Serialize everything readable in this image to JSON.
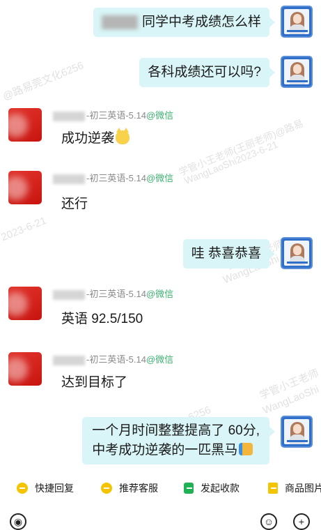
{
  "messages": {
    "m1": {
      "text": "同学中考成绩怎么样"
    },
    "m2": {
      "text": "各科成绩还可以吗?"
    },
    "m3": {
      "sender_suffix": "-初三英语-5.14",
      "wechat": "@微信",
      "text": "成功逆袭"
    },
    "m4": {
      "sender_suffix": "-初三英语-5.14",
      "wechat": "@微信",
      "text": "还行"
    },
    "m5": {
      "text": "哇 恭喜恭喜"
    },
    "m6": {
      "sender_suffix": "-初三英语-5.14",
      "wechat": "@微信",
      "text": "英语 92.5/150"
    },
    "m7": {
      "sender_suffix": "-初三英语-5.14",
      "wechat": "@微信",
      "text": "达到目标了"
    },
    "m8": {
      "line1": "一个月时间整整提高了 60分,",
      "line2": "中考成功逆袭的一匹黑马"
    }
  },
  "watermarks": {
    "w1": "@路易莞文化6256",
    "w2": "学管小王老师(王丽老师)@路易",
    "w3": "WangLaoShi2023-6-21",
    "w4": "学管小王老师",
    "w5": "WangLaoShi",
    "w6": "6256",
    "w7": "学管小王老师",
    "w8": "WangLaoShi",
    "w9": "2023-6-21"
  },
  "quick": {
    "q1": "快捷回复",
    "q2": "推荐客服",
    "q3": "发起收款",
    "q4": "商品图片"
  },
  "colors": {
    "outgoing_bubble": "#d9f5f7",
    "wechat_green": "#3cb371",
    "avatar_red": "#d9201a"
  }
}
